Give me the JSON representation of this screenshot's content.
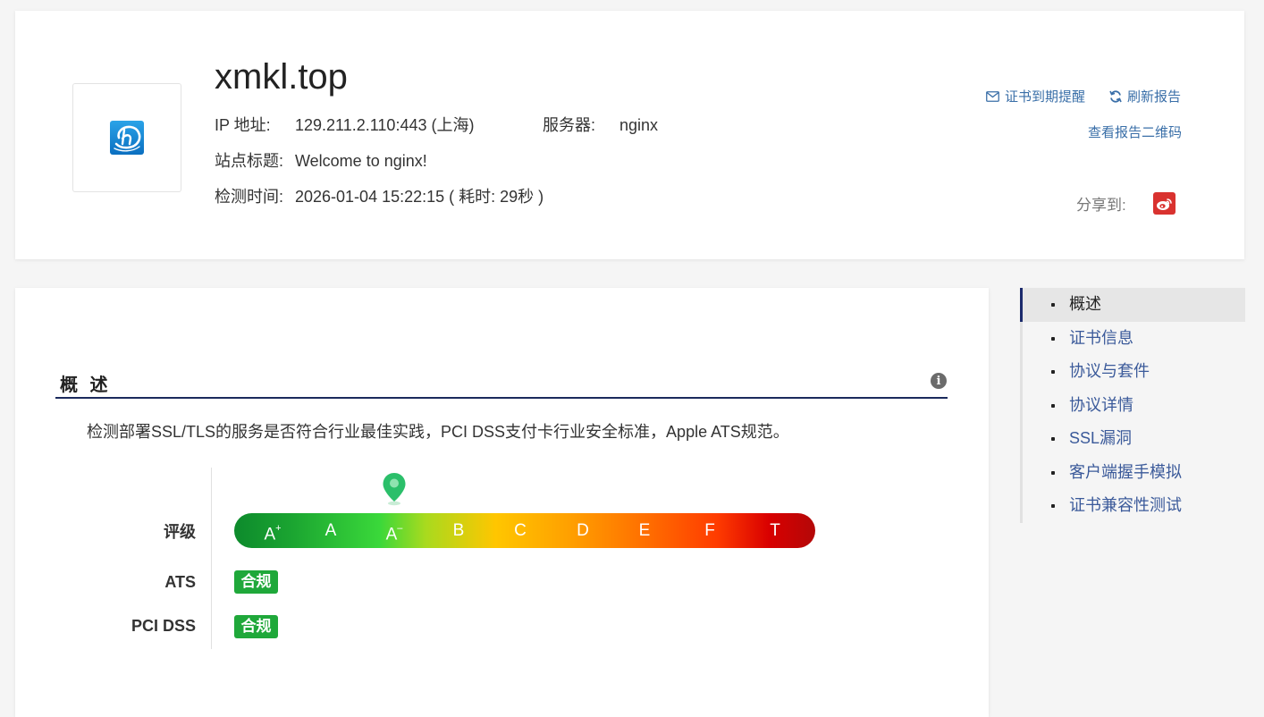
{
  "header": {
    "domain": "xmkl.top",
    "ip_label": "IP 地址:",
    "ip_value": "129.211.2.110:443 (上海)",
    "server_label": "服务器:",
    "server_value": "nginx",
    "title_label": "站点标题:",
    "title_value": "Welcome to nginx!",
    "time_label": "检测时间:",
    "time_value": "2026-01-04 15:22:15 ( 耗时: 29秒 )",
    "cert_reminder": "证书到期提醒",
    "refresh_report": "刷新报告",
    "view_qrcode": "查看报告二维码",
    "share_label": "分享到:",
    "share_icon": "weibo-icon"
  },
  "overview": {
    "title": "概 述",
    "description": "检测部署SSL/TLS的服务是否符合行业最佳实践，PCI DSS支付卡行业安全标准，Apple ATS规范。",
    "grade_label": "评级",
    "grades": [
      "A+",
      "A",
      "A-",
      "B",
      "C",
      "D",
      "E",
      "F",
      "T"
    ],
    "current_grade": "A-",
    "ats_label": "ATS",
    "ats_status": "合规",
    "pci_label": "PCI DSS",
    "pci_status": "合规",
    "pass_color": "#1fa83a"
  },
  "sidebar": {
    "items": [
      {
        "label": "概述",
        "active": true
      },
      {
        "label": "证书信息",
        "active": false
      },
      {
        "label": "协议与套件",
        "active": false
      },
      {
        "label": "协议详情",
        "active": false
      },
      {
        "label": "SSL漏洞",
        "active": false
      },
      {
        "label": "客户端握手模拟",
        "active": false
      },
      {
        "label": "证书兼容性测试",
        "active": false
      }
    ]
  }
}
